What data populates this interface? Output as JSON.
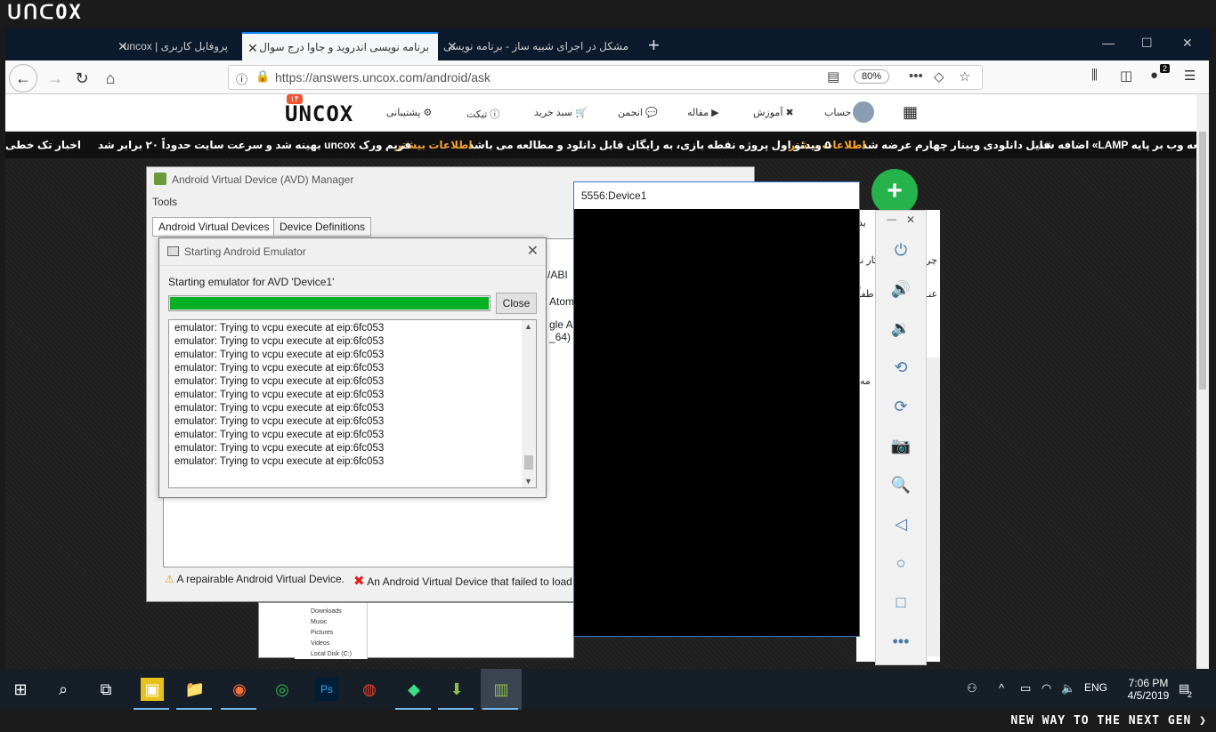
{
  "brand": {
    "logo": "ᑌᑎᑕOX",
    "slogan": "NEW WAY TO THE NEXT GEN ❯"
  },
  "browser": {
    "tabs": [
      {
        "label": "پروفایل کاربری | uncox",
        "active": false
      },
      {
        "label": "برنامه نویسی اندروید و جاوا درج سوال",
        "active": true
      },
      {
        "label": "مشکل در اجرای شبیه ساز - برنامه نویسی",
        "active": false
      }
    ],
    "url": "https://answers.uncox.com/android/ask",
    "zoom": "80%",
    "library_badge": "2"
  },
  "site": {
    "logo": "UNCOX",
    "logo_badge": "۱۴",
    "menu": {
      "account": "حساب",
      "learning": "آموزش",
      "article": "مقاله",
      "forum": "انجمن",
      "cart": "سبد خرید",
      "ticket": "تیکت",
      "support": "پشتیبانی"
    }
  },
  "ticker": {
    "items": [
      "توسعه وب بر پایه LAMP» اضافه شد",
      "فایل دانلودی وبینار چهارم عرضه شد",
      "اطلاعات بیشتر",
      "۵ ویدئو اول پروژه نقطه بازی، به رایگان قابل دانلود و مطالعه می باشد",
      "اطلاعات بیشتر",
      "فریم ورک uncox بهینه شد و سرعت سایت حدوداً ۲۰ برابر شد",
      "اخبار تک خطی"
    ]
  },
  "avd": {
    "title": "Android Virtual Device (AVD) Manager",
    "menu_tools": "Tools",
    "tab_avds": "Android Virtual Devices",
    "tab_defs": "Device Definitions",
    "col_abi": "/ABI",
    "cell_atom": "Atom",
    "cell_gle": "gle AP",
    "cell_64": "_64)",
    "legend_repairable": "A repairable Android Virtual Device.",
    "legend_failed": "An Android Virtual Device that failed to load."
  },
  "dialog": {
    "title": "Starting Android Emulator",
    "message": "Starting emulator for AVD 'Device1'",
    "progress": 1.0,
    "close_label": "Close",
    "log_lines": [
      "emulator: Trying to vcpu execute at eip:6fc053",
      "emulator: Trying to vcpu execute at eip:6fc053",
      "emulator: Trying to vcpu execute at eip:6fc053",
      "emulator: Trying to vcpu execute at eip:6fc053",
      "emulator: Trying to vcpu execute at eip:6fc053",
      "emulator: Trying to vcpu execute at eip:6fc053",
      "emulator: Trying to vcpu execute at eip:6fc053",
      "emulator: Trying to vcpu execute at eip:6fc053",
      "emulator: Trying to vcpu execute at eip:6fc053",
      "emulator: Trying to vcpu execute at eip:6fc053",
      "emulator: Trying to vcpu execute at eip:6fc053"
    ]
  },
  "device": {
    "title": "5556:Device1"
  },
  "background_fragments": {
    "frag_1": "ید",
    "frag_2": "کار نـ",
    "frag_3": "چر",
    "frag_4": "عنـ",
    "frag_5": "طفاً",
    "frag_6": "مه",
    "explorer_items": [
      "Downloads",
      "Music",
      "Pictures",
      "Videos",
      "Local Disk (C:)"
    ]
  },
  "taskbar": {
    "lang": "ENG",
    "time": "7:06 PM",
    "date": "4/5/2019",
    "notif_count": "2"
  }
}
